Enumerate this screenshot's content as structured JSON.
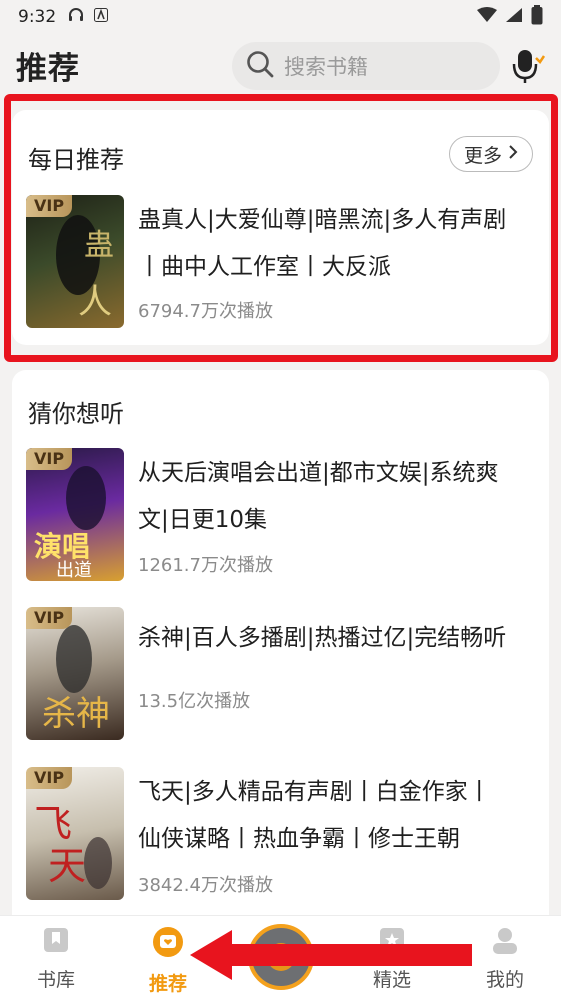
{
  "status_bar": {
    "time": "9:32"
  },
  "header": {
    "title": "推荐",
    "search_placeholder": "搜索书籍"
  },
  "daily": {
    "title": "每日推荐",
    "more_label": "更多",
    "book": {
      "vip": "VIP",
      "title_line1": "蛊真人|大爱仙尊|暗黑流|多人有声剧",
      "title_line2": "丨曲中人工作室丨大反派",
      "plays": "6794.7万次播放"
    }
  },
  "guess": {
    "title": "猜你想听",
    "books": [
      {
        "vip": "VIP",
        "title_line1": "从天后演唱会出道|都市文娱|系统爽",
        "title_line2": "文|日更10集",
        "plays": "1261.7万次播放"
      },
      {
        "vip": "VIP",
        "title_line1": "杀神|百人多播剧|热播过亿|完结畅听",
        "title_line2": "",
        "plays": "13.5亿次播放"
      },
      {
        "vip": "VIP",
        "title_line1": "飞天|多人精品有声剧丨白金作家丨",
        "title_line2": "仙侠谋略丨热血争霸丨修士王朝",
        "plays": "3842.4万次播放"
      }
    ]
  },
  "tabs": [
    {
      "label": "书库",
      "icon": "bookmark-icon"
    },
    {
      "label": "推荐",
      "icon": "heart-chat-icon",
      "active": true
    },
    {
      "label": "精选",
      "icon": "star-icon"
    },
    {
      "label": "我的",
      "icon": "user-icon"
    }
  ],
  "colors": {
    "accent": "#f29a11",
    "highlight": "#e8141e",
    "vip": "#c9a86a"
  }
}
